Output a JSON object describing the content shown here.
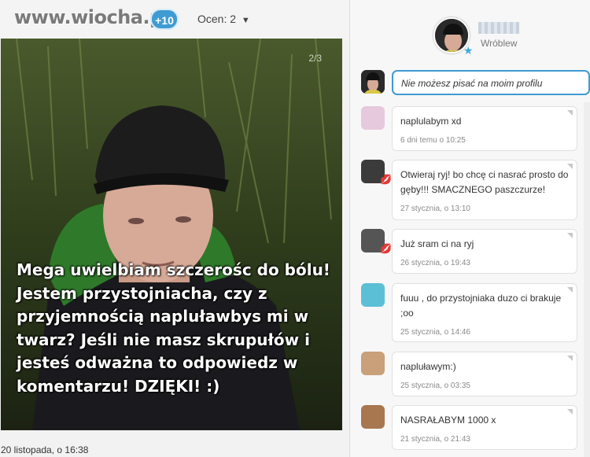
{
  "header": {
    "logo": "www.wiocha.pl",
    "plus_badge": "+10",
    "rating_label": "Ocen: 2"
  },
  "photo": {
    "counter": "2/3",
    "caption": "Mega uwielbiam szczerośc do bólu! Jestem przystojniacha, czy z przyjemnością napluławbys mi w twarz? Jeśli nie masz skrupułów i jesteś odważna to odpowiedz w komentarzu! DZIĘKI! :)"
  },
  "post_date": "20 listopada, o 16:38",
  "profile": {
    "name": "Wróblew"
  },
  "own_message": "Nie możesz pisać na moim profilu",
  "comments": [
    {
      "text": "naplulabym xd",
      "time": "6 dni temu o 10:25",
      "avatar_color": "#e6c9dd"
    },
    {
      "text": "Otwieraj ryj! bo chcę ci nasrać prosto do gęby!!! SMACZNEGO paszczurze!",
      "time": "27 stycznia, o 13:10",
      "avatar_color": "#3b3b3b",
      "lips": true
    },
    {
      "text": "Już sram ci na ryj",
      "time": "26 stycznia, o 19:43",
      "avatar_color": "#555555",
      "lips": true
    },
    {
      "text": "fuuu , do przystojniaka duzo ci brakuje ;oo",
      "time": "25 stycznia, o 14:46",
      "avatar_color": "#5bbfd6"
    },
    {
      "text": "napluławym:)",
      "time": "25 stycznia, o 03:35",
      "avatar_color": "#c9a07a"
    },
    {
      "text": "NASRAŁABYM 1000 x",
      "time": "21 stycznia, o 21:43",
      "avatar_color": "#a8764f"
    }
  ]
}
